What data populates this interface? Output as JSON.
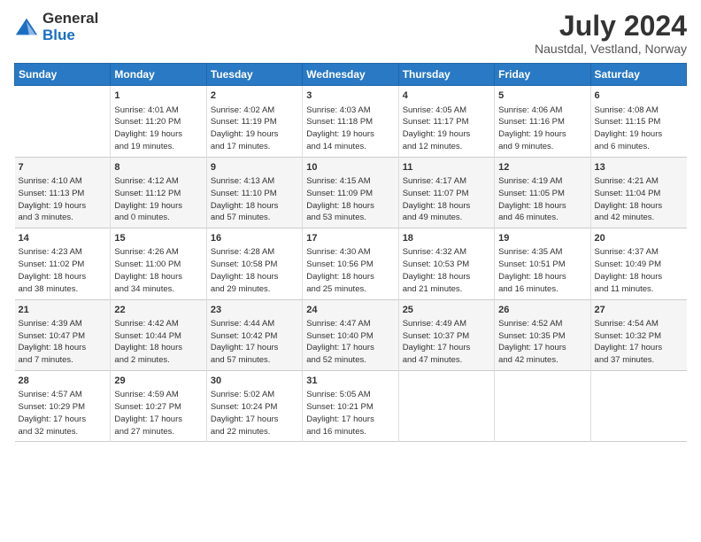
{
  "logo": {
    "general": "General",
    "blue": "Blue"
  },
  "header": {
    "title": "July 2024",
    "subtitle": "Naustdal, Vestland, Norway"
  },
  "columns": [
    "Sunday",
    "Monday",
    "Tuesday",
    "Wednesday",
    "Thursday",
    "Friday",
    "Saturday"
  ],
  "weeks": [
    [
      {
        "day": "",
        "info": ""
      },
      {
        "day": "1",
        "info": "Sunrise: 4:01 AM\nSunset: 11:20 PM\nDaylight: 19 hours\nand 19 minutes."
      },
      {
        "day": "2",
        "info": "Sunrise: 4:02 AM\nSunset: 11:19 PM\nDaylight: 19 hours\nand 17 minutes."
      },
      {
        "day": "3",
        "info": "Sunrise: 4:03 AM\nSunset: 11:18 PM\nDaylight: 19 hours\nand 14 minutes."
      },
      {
        "day": "4",
        "info": "Sunrise: 4:05 AM\nSunset: 11:17 PM\nDaylight: 19 hours\nand 12 minutes."
      },
      {
        "day": "5",
        "info": "Sunrise: 4:06 AM\nSunset: 11:16 PM\nDaylight: 19 hours\nand 9 minutes."
      },
      {
        "day": "6",
        "info": "Sunrise: 4:08 AM\nSunset: 11:15 PM\nDaylight: 19 hours\nand 6 minutes."
      }
    ],
    [
      {
        "day": "7",
        "info": "Sunrise: 4:10 AM\nSunset: 11:13 PM\nDaylight: 19 hours\nand 3 minutes."
      },
      {
        "day": "8",
        "info": "Sunrise: 4:12 AM\nSunset: 11:12 PM\nDaylight: 19 hours\nand 0 minutes."
      },
      {
        "day": "9",
        "info": "Sunrise: 4:13 AM\nSunset: 11:10 PM\nDaylight: 18 hours\nand 57 minutes."
      },
      {
        "day": "10",
        "info": "Sunrise: 4:15 AM\nSunset: 11:09 PM\nDaylight: 18 hours\nand 53 minutes."
      },
      {
        "day": "11",
        "info": "Sunrise: 4:17 AM\nSunset: 11:07 PM\nDaylight: 18 hours\nand 49 minutes."
      },
      {
        "day": "12",
        "info": "Sunrise: 4:19 AM\nSunset: 11:05 PM\nDaylight: 18 hours\nand 46 minutes."
      },
      {
        "day": "13",
        "info": "Sunrise: 4:21 AM\nSunset: 11:04 PM\nDaylight: 18 hours\nand 42 minutes."
      }
    ],
    [
      {
        "day": "14",
        "info": "Sunrise: 4:23 AM\nSunset: 11:02 PM\nDaylight: 18 hours\nand 38 minutes."
      },
      {
        "day": "15",
        "info": "Sunrise: 4:26 AM\nSunset: 11:00 PM\nDaylight: 18 hours\nand 34 minutes."
      },
      {
        "day": "16",
        "info": "Sunrise: 4:28 AM\nSunset: 10:58 PM\nDaylight: 18 hours\nand 29 minutes."
      },
      {
        "day": "17",
        "info": "Sunrise: 4:30 AM\nSunset: 10:56 PM\nDaylight: 18 hours\nand 25 minutes."
      },
      {
        "day": "18",
        "info": "Sunrise: 4:32 AM\nSunset: 10:53 PM\nDaylight: 18 hours\nand 21 minutes."
      },
      {
        "day": "19",
        "info": "Sunrise: 4:35 AM\nSunset: 10:51 PM\nDaylight: 18 hours\nand 16 minutes."
      },
      {
        "day": "20",
        "info": "Sunrise: 4:37 AM\nSunset: 10:49 PM\nDaylight: 18 hours\nand 11 minutes."
      }
    ],
    [
      {
        "day": "21",
        "info": "Sunrise: 4:39 AM\nSunset: 10:47 PM\nDaylight: 18 hours\nand 7 minutes."
      },
      {
        "day": "22",
        "info": "Sunrise: 4:42 AM\nSunset: 10:44 PM\nDaylight: 18 hours\nand 2 minutes."
      },
      {
        "day": "23",
        "info": "Sunrise: 4:44 AM\nSunset: 10:42 PM\nDaylight: 17 hours\nand 57 minutes."
      },
      {
        "day": "24",
        "info": "Sunrise: 4:47 AM\nSunset: 10:40 PM\nDaylight: 17 hours\nand 52 minutes."
      },
      {
        "day": "25",
        "info": "Sunrise: 4:49 AM\nSunset: 10:37 PM\nDaylight: 17 hours\nand 47 minutes."
      },
      {
        "day": "26",
        "info": "Sunrise: 4:52 AM\nSunset: 10:35 PM\nDaylight: 17 hours\nand 42 minutes."
      },
      {
        "day": "27",
        "info": "Sunrise: 4:54 AM\nSunset: 10:32 PM\nDaylight: 17 hours\nand 37 minutes."
      }
    ],
    [
      {
        "day": "28",
        "info": "Sunrise: 4:57 AM\nSunset: 10:29 PM\nDaylight: 17 hours\nand 32 minutes."
      },
      {
        "day": "29",
        "info": "Sunrise: 4:59 AM\nSunset: 10:27 PM\nDaylight: 17 hours\nand 27 minutes."
      },
      {
        "day": "30",
        "info": "Sunrise: 5:02 AM\nSunset: 10:24 PM\nDaylight: 17 hours\nand 22 minutes."
      },
      {
        "day": "31",
        "info": "Sunrise: 5:05 AM\nSunset: 10:21 PM\nDaylight: 17 hours\nand 16 minutes."
      },
      {
        "day": "",
        "info": ""
      },
      {
        "day": "",
        "info": ""
      },
      {
        "day": "",
        "info": ""
      }
    ]
  ]
}
